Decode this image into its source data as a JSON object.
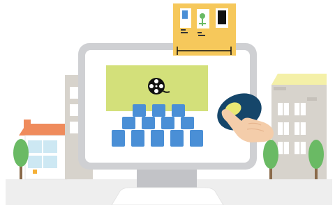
{
  "scene": {
    "icons": [
      "film-reel-icon",
      "tap-hand-icon",
      "corkboard-icon"
    ],
    "colors": {
      "monitor_frame": "#cfd0d3",
      "screen": "#ffffff",
      "banner": "#d3e07a",
      "seat_blue": "#4a8fd6",
      "corkboard": "#f6c85b",
      "badge_navy": "#15466a",
      "badge_yellow": "#e9e874",
      "roof_orange": "#ef8b5c",
      "tree_green": "#6aba64",
      "ground": "#eeeeee"
    }
  }
}
